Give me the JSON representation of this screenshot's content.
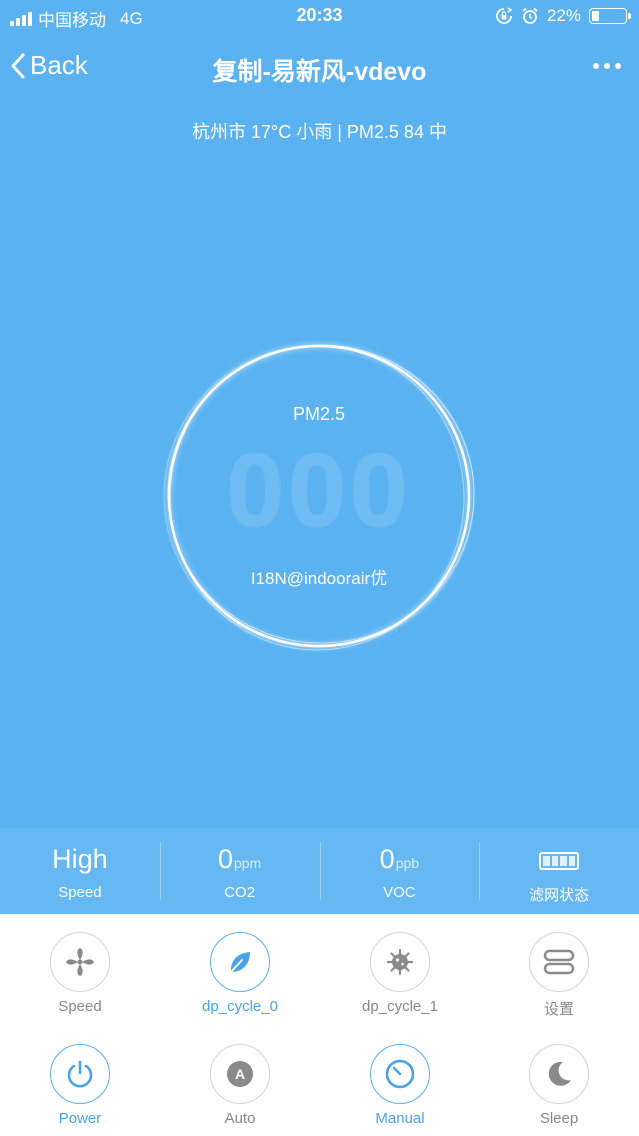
{
  "status_bar": {
    "carrier": "中国移动",
    "network": "4G",
    "time": "20:33",
    "battery_text": "22%",
    "battery_level": 0.22
  },
  "nav": {
    "back_label": "Back",
    "title": "复制-易新风-vdevo"
  },
  "weather": "杭州市 17°C 小雨 | PM2.5 84 中",
  "gauge": {
    "label": "PM2.5",
    "value": "000",
    "quality": "I18N@indoorair优"
  },
  "stats": [
    {
      "value": "High",
      "unit": "",
      "label": "Speed"
    },
    {
      "value": "0",
      "unit": "ppm",
      "label": "CO2"
    },
    {
      "value": "0",
      "unit": "ppb",
      "label": "VOC"
    },
    {
      "label": "滤网状态"
    }
  ],
  "controls": [
    {
      "label": "Speed",
      "icon": "fan-icon",
      "active": false
    },
    {
      "label": "dp_cycle_0",
      "icon": "leaf-icon",
      "active": true
    },
    {
      "label": "dp_cycle_1",
      "icon": "virus-icon",
      "active": false
    },
    {
      "label": "设置",
      "icon": "settings-icon",
      "active": false
    },
    {
      "label": "Power",
      "icon": "power-icon",
      "active": true
    },
    {
      "label": "Auto",
      "icon": "auto-icon",
      "active": false
    },
    {
      "label": "Manual",
      "icon": "timer-icon",
      "active": true
    },
    {
      "label": "Sleep",
      "icon": "moon-icon",
      "active": false
    }
  ],
  "colors": {
    "background": "#5ab2f1",
    "accent": "#4aa3e8",
    "inactive": "#888888"
  }
}
